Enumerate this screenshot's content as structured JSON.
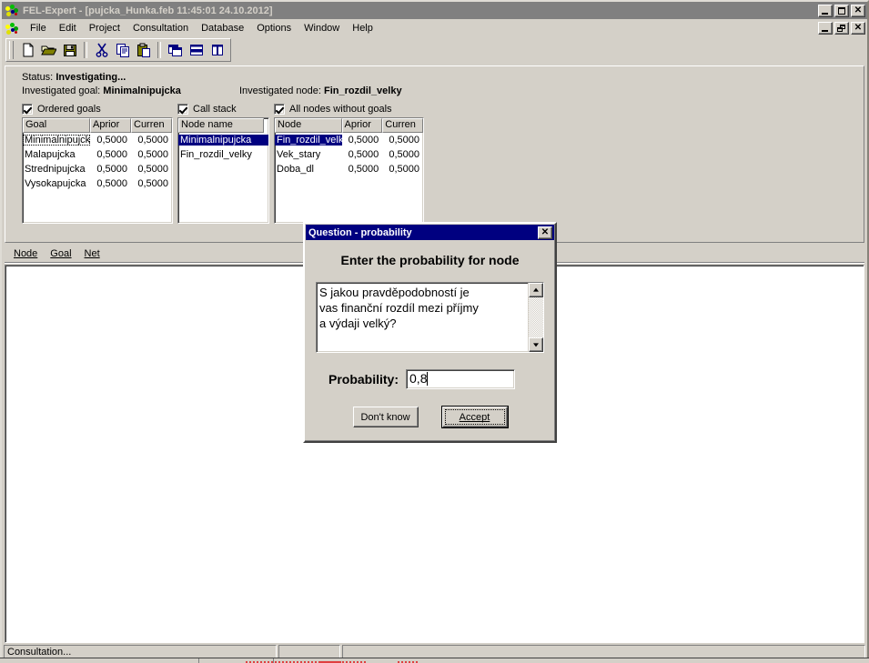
{
  "window": {
    "title": "FEL-Expert - [pujcka_Hunka.feb 11:45:01 24.10.2012]",
    "app_icon": "expert-system-icon",
    "minimize": "_",
    "maximize": "□",
    "close": "✕",
    "child_minimize": "_",
    "child_restore": "❐",
    "child_close": "✕"
  },
  "menu": {
    "items": [
      {
        "label": "File"
      },
      {
        "label": "Edit"
      },
      {
        "label": "Project"
      },
      {
        "label": "Consultation"
      },
      {
        "label": "Database"
      },
      {
        "label": "Options"
      },
      {
        "label": "Window"
      },
      {
        "label": "Help"
      }
    ]
  },
  "toolbar": {
    "buttons": [
      {
        "name": "new-document-icon",
        "title": "New"
      },
      {
        "name": "open-folder-icon",
        "title": "Open"
      },
      {
        "name": "save-disk-icon",
        "title": "Save"
      },
      {
        "name": "cut-scissors-icon",
        "title": "Cut"
      },
      {
        "name": "copy-icon",
        "title": "Copy"
      },
      {
        "name": "paste-clipboard-icon",
        "title": "Paste"
      },
      {
        "name": "cascade-windows-icon",
        "title": "Cascade"
      },
      {
        "name": "tile-horizontal-icon",
        "title": "Tile Horizontally"
      },
      {
        "name": "tile-vertical-icon",
        "title": "Tile Vertically"
      }
    ]
  },
  "consultation": {
    "status_label": "Status:",
    "status_value": "Investigating...",
    "goal_label": "Investigated goal:",
    "goal_value": "Minimalnipujcka",
    "node_label": "Investigated node:",
    "node_value": "Fin_rozdil_velky",
    "ordered_goals": {
      "checkbox_label": "Ordered goals",
      "checked": true,
      "columns": [
        "Goal",
        "Aprior",
        "Curren"
      ],
      "rows": [
        {
          "name": "Minimalnipujcka",
          "aprior": "0,5000",
          "current": "0,5000",
          "focused": true
        },
        {
          "name": "Malapujcka",
          "aprior": "0,5000",
          "current": "0,5000",
          "focused": false
        },
        {
          "name": "Strednipujcka",
          "aprior": "0,5000",
          "current": "0,5000",
          "focused": false
        },
        {
          "name": "Vysokapujcka",
          "aprior": "0,5000",
          "current": "0,5000",
          "focused": false
        }
      ]
    },
    "call_stack": {
      "checkbox_label": "Call stack",
      "checked": true,
      "columns": [
        "Node name"
      ],
      "rows": [
        {
          "name": "Minimalnipujcka",
          "selected": true
        },
        {
          "name": "Fin_rozdil_velky",
          "selected": false
        }
      ]
    },
    "all_nodes": {
      "checkbox_label": "All nodes without goals",
      "checked": true,
      "columns": [
        "Node",
        "Aprior",
        "Curren"
      ],
      "rows": [
        {
          "name": "Fin_rozdil_velky",
          "aprior": "0,5000",
          "current": "0,5000",
          "selected": true
        },
        {
          "name": "Vek_stary",
          "aprior": "0,5000",
          "current": "0,5000",
          "selected": false
        },
        {
          "name": "Doba_dl",
          "aprior": "0,5000",
          "current": "0,5000",
          "selected": false
        }
      ]
    }
  },
  "mdi_child": {
    "menu": [
      {
        "label": "Node",
        "accel": "N"
      },
      {
        "label": "Goal",
        "accel": "l"
      },
      {
        "label": "Net",
        "accel": "N"
      }
    ]
  },
  "statusbar": {
    "panel1": "Consultation...",
    "panel2": "",
    "panel3": ""
  },
  "dialog": {
    "title": "Question - probability",
    "close_label": "✕",
    "heading": "Enter the probability for node",
    "question_text": "S jakou pravděpodobností je\nvas finanční rozdíl mezi příjmy\na výdaji velký?",
    "probability_label": "Probability:",
    "probability_value": "0,8",
    "dont_know_button": "Don't know",
    "accept_button": "Accept",
    "accept_accel": "A"
  },
  "colors": {
    "face": "#d4d0c8",
    "title_inactive": "#808080",
    "title_active": "#000080",
    "selection": "#000080",
    "selection_text": "#ffffff",
    "window": "#ffffff"
  }
}
